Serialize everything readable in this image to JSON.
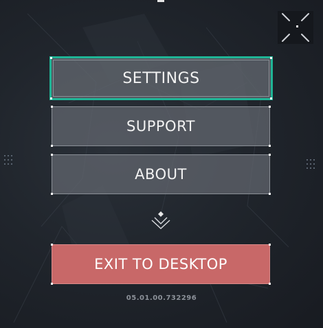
{
  "menu": {
    "items": [
      {
        "label": "SETTINGS",
        "selected": true
      },
      {
        "label": "SUPPORT",
        "selected": false
      },
      {
        "label": "ABOUT",
        "selected": false
      }
    ],
    "exit_label": "EXIT TO DESKTOP"
  },
  "version": "05.01.00.732296",
  "icons": {
    "collapse": "collapse-arrows-icon",
    "more": "chevron-down-more-icon"
  },
  "colors": {
    "selected_outline": "#1fb596",
    "exit_button": "#c86868",
    "button_fill": "#64686f",
    "background": "#1f242b"
  }
}
